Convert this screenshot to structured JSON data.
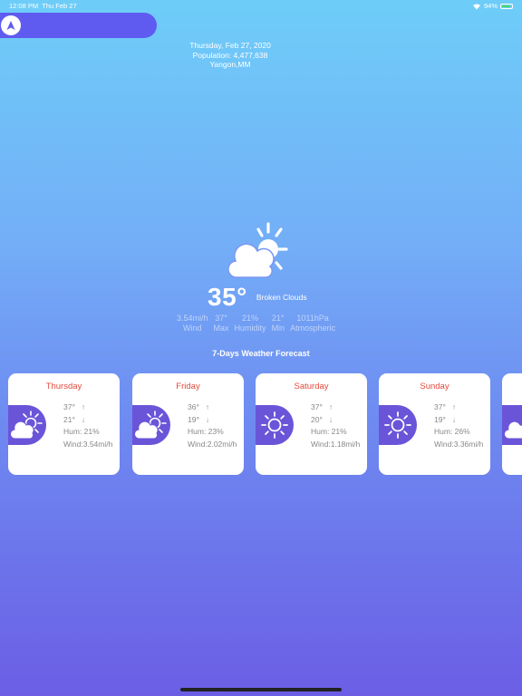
{
  "status": {
    "time": "12:08 PM",
    "date": "Thu Feb 27",
    "battery": "94%"
  },
  "header": {
    "date": "Thursday, Feb 27, 2020",
    "population": "Population: 4,477,638",
    "location": "Yangon,MM"
  },
  "current": {
    "temp": "35°",
    "condition": "Broken Clouds",
    "icon": "partly-cloudy-icon"
  },
  "stats": [
    {
      "value": "3.54mi/h",
      "label": "Wind"
    },
    {
      "value": "37°",
      "label": "Max"
    },
    {
      "value": "21%",
      "label": "Humidity"
    },
    {
      "value": "21°",
      "label": "Min"
    },
    {
      "value": "1011hPa",
      "label": "Atmospheric"
    }
  ],
  "forecast": {
    "title": "7-Days Weather Forecast",
    "days": [
      {
        "day": "Thursday",
        "max": "37°",
        "min": "21°",
        "hum": "Hum: 21%",
        "wind": "Wind:3.54mi/h",
        "icon": "partly-cloudy-icon"
      },
      {
        "day": "Friday",
        "max": "36°",
        "min": "19°",
        "hum": "Hum: 23%",
        "wind": "Wind:2.02mi/h",
        "icon": "partly-cloudy-icon"
      },
      {
        "day": "Saturday",
        "max": "37°",
        "min": "20°",
        "hum": "Hum: 21%",
        "wind": "Wind:1.18mi/h",
        "icon": "sun-icon"
      },
      {
        "day": "Sunday",
        "max": "37°",
        "min": "19°",
        "hum": "Hum: 26%",
        "wind": "Wind:3.36mi/h",
        "icon": "sun-icon"
      }
    ]
  }
}
